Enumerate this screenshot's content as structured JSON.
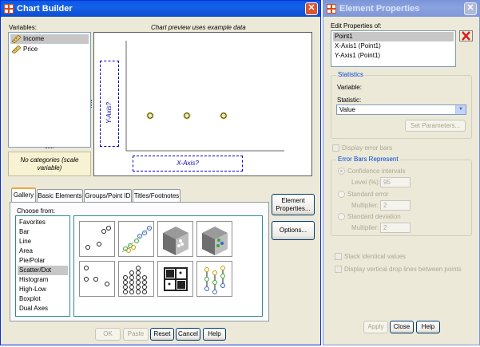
{
  "chart_builder": {
    "title": "Chart Builder",
    "variables_label": "Variables:",
    "variables": [
      "Income",
      "Price"
    ],
    "no_categories_text": "No categories (scale variable)",
    "preview_caption": "Chart preview uses example data",
    "y_axis_drop": "Y-Axis?",
    "x_axis_drop": "X-Axis?",
    "tabs": [
      "Gallery",
      "Basic Elements",
      "Groups/Point ID",
      "Titles/Footnotes"
    ],
    "choose_from_label": "Choose from:",
    "chart_types": [
      "Favorites",
      "Bar",
      "Line",
      "Area",
      "Pie/Polar",
      "Scatter/Dot",
      "Histogram",
      "High-Low",
      "Boxplot",
      "Dual Axes"
    ],
    "selected_type": "Scatter/Dot",
    "element_properties_button": "Element Properties...",
    "options_button": "Options...",
    "footer_buttons": {
      "ok": "OK",
      "paste": "Paste",
      "reset": "Reset",
      "cancel": "Cancel",
      "help": "Help"
    }
  },
  "element_properties": {
    "title": "Element Properties",
    "edit_properties_label": "Edit Properties of:",
    "elements": [
      "Point1",
      "X-Axis1 (Point1)",
      "Y-Axis1 (Point1)"
    ],
    "delete_icon": "red-x-icon",
    "statistics_group": "Statistics",
    "variable_label": "Variable:",
    "statistic_label": "Statistic:",
    "statistic_value": "Value",
    "set_parameters_button": "Set Parameters...",
    "display_error_bars": "Display error bars",
    "error_bars_group": "Error Bars Represent",
    "confidence_intervals": "Confidence intervals",
    "level_label": "Level (%):",
    "level_value": "95",
    "standard_error": "Standard error",
    "standard_deviation": "Standard deviation",
    "multiplier_label": "Multiplier:",
    "se_multiplier": "2",
    "sd_multiplier": "2",
    "stack_identical": "Stack identical values",
    "drop_lines": "Display vertical drop lines between points",
    "footer_buttons": {
      "apply": "Apply",
      "close": "Close",
      "help": "Help"
    }
  },
  "colors": {
    "titlebar": "#0a58e4",
    "window_bg": "#ece9d8",
    "group_title": "#0046d5",
    "close_button": "#e0552e"
  }
}
